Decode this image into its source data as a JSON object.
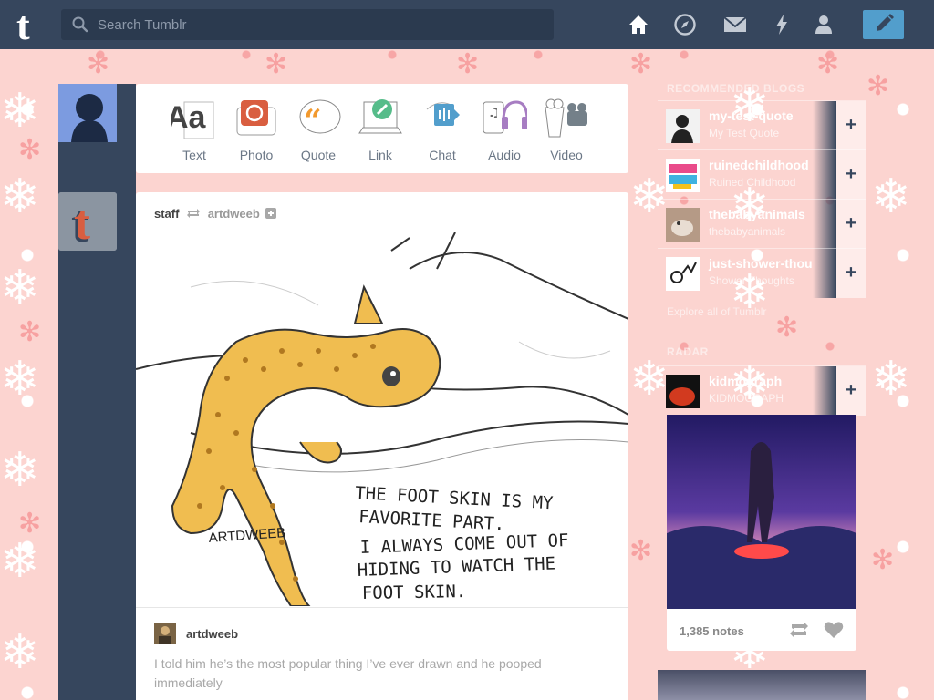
{
  "header": {
    "search_placeholder": "Search Tumblr",
    "nav": [
      "home-icon",
      "explore-compass-icon",
      "inbox-mail-icon",
      "activity-lightning-icon",
      "account-person-icon"
    ],
    "compose": "pencil-icon"
  },
  "composer": {
    "types": [
      {
        "label": "Text",
        "color": "#444444"
      },
      {
        "label": "Photo",
        "color": "#d95e40"
      },
      {
        "label": "Quote",
        "color": "#f2992e"
      },
      {
        "label": "Link",
        "color": "#56bc8a"
      },
      {
        "label": "Chat",
        "color": "#529ecc"
      },
      {
        "label": "Audio",
        "color": "#a77dc2"
      },
      {
        "label": "Video",
        "color": "#748089"
      }
    ]
  },
  "post": {
    "author": "staff",
    "reblogged_from": "artdweeb",
    "drawing_text": {
      "line1": "THE FOOT SKIN IS MY",
      "line2": "FAVORITE PART.",
      "line3": "I ALWAYS COME OUT OF",
      "line4": "HIDING TO WATCH THE",
      "line5": "FOOT SKIN.",
      "signature": "ARTDWEEB"
    },
    "caption_author": "artdweeb",
    "caption": "I told him he’s the most popular thing I’ve ever drawn and he pooped immediately"
  },
  "sidebar": {
    "recommended_title": "RECOMMENDED BLOGS",
    "blogs": [
      {
        "name": "my-test-quote",
        "sub": "My Test Quote"
      },
      {
        "name": "ruinedchildhood",
        "sub": "Ruined Childhood"
      },
      {
        "name": "thebabyanimals",
        "sub": "thebabyanimals"
      },
      {
        "name": "just-shower-thou",
        "sub": "Shower Thoughts"
      }
    ],
    "explore_link": "Explore all of Tumblr",
    "radar_title": "RADAR",
    "radar_blog": {
      "name": "kidmograph",
      "sub": "KIDMOGRAPH"
    },
    "notes": "1,385 notes"
  }
}
